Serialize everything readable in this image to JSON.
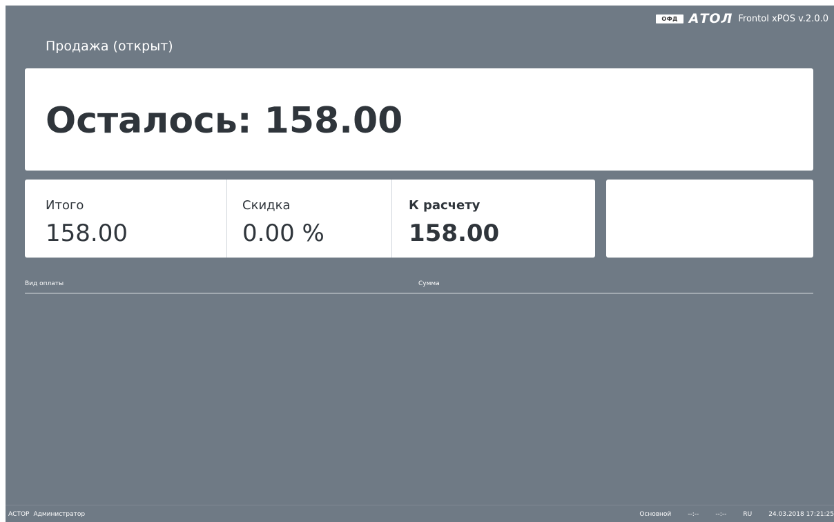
{
  "header": {
    "ofd_badge": "ОФД",
    "logo_text": "АТОЛ",
    "version": "Frontol xPOS v.2.0.0"
  },
  "page_title": "Продажа (открыт)",
  "remaining": {
    "label": "Осталось: 158.00"
  },
  "totals": {
    "total_label": "Итого",
    "total_value": "158.00",
    "discount_label": "Скидка",
    "discount_value": "0.00 %",
    "due_label": "К расчету",
    "due_value": "158.00"
  },
  "payments_table": {
    "columns": [
      "Вид оплаты",
      "Сумма"
    ],
    "rows": []
  },
  "status_bar": {
    "shop": "АСТОР",
    "user": "Администратор",
    "profile": "Основной",
    "time1": "--:--",
    "time2": "--:--",
    "lang": "RU",
    "datetime": "24.03.2018 17:21:25"
  }
}
